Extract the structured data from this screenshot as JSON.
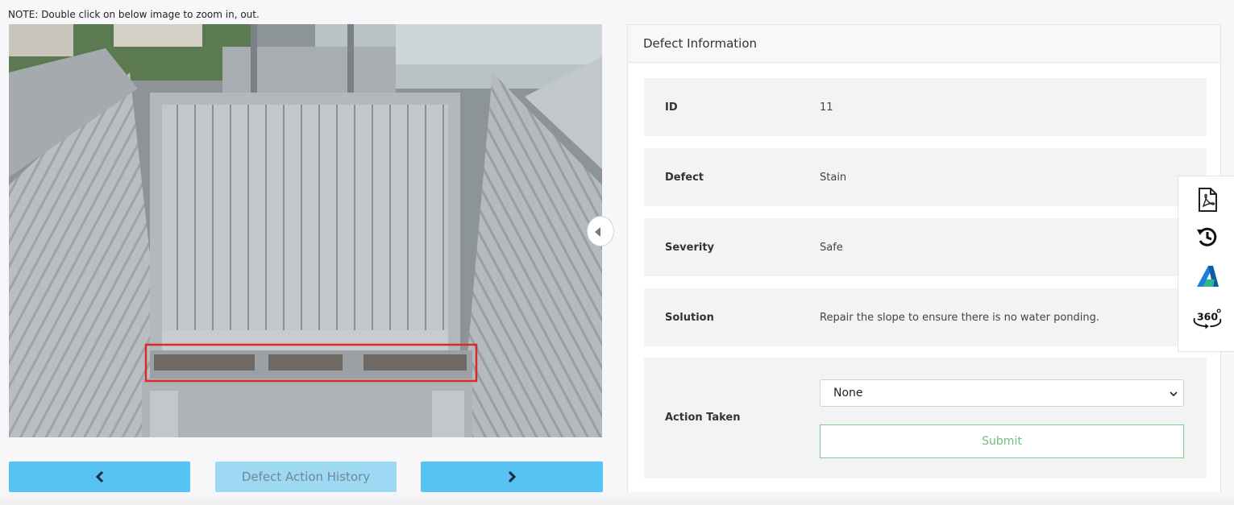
{
  "note": "NOTE: Double click on below image to zoom in, out.",
  "nav": {
    "history_label": "Defect Action History",
    "prev_icon": "chevron-left-icon",
    "next_icon": "chevron-right-icon"
  },
  "panel": {
    "title": "Defect Information",
    "fields": {
      "id": {
        "label": "ID",
        "value": "11"
      },
      "defect": {
        "label": "Defect",
        "value": "Stain"
      },
      "severity": {
        "label": "Severity",
        "value": "Safe"
      },
      "solution": {
        "label": "Solution",
        "value": "Repair the slope to ensure there is no water ponding."
      },
      "action": {
        "label": "Action Taken",
        "selected": "None"
      }
    },
    "submit_label": "Submit"
  },
  "toolbar": {
    "icons": [
      "pdf-icon",
      "history-icon",
      "autodesk-icon",
      "360-view-icon"
    ],
    "view_360_label": "360"
  },
  "colors": {
    "nav_button": "#56c3f2",
    "nav_button_disabled": "#9ed9f4",
    "submit_border": "#86c98e",
    "defect_box": "#d92a2a",
    "autodesk_blue": "#1f7fd6"
  }
}
